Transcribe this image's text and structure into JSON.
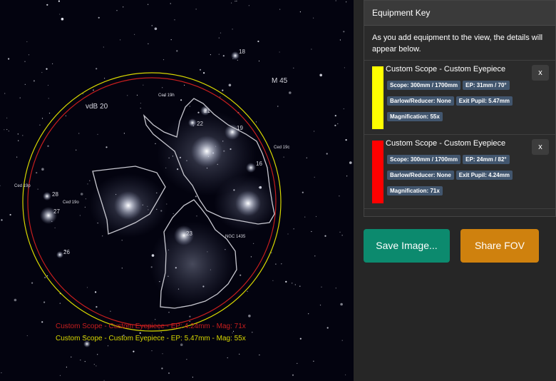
{
  "sky": {
    "labels": {
      "m45": "M 45",
      "vdb20": "vdB 20",
      "ced19h": "Ced 19h",
      "ced19c": "Ced 19c",
      "ced19p": "Ced 19p",
      "ced19o": "Ced 19o",
      "ngc1435": "NGC 1435",
      "s18a": "18",
      "s21": "21",
      "s22": "22",
      "s19": "19",
      "s16": "16",
      "s28": "28",
      "s27": "27",
      "s23": "23",
      "s26": "26"
    },
    "captions": {
      "red": "Custom Scope - Custom Eyepiece - EP: 4.24mm - Mag: 71x",
      "yellow": "Custom Scope - Custom Eyepiece - EP: 5.47mm - Mag: 55x"
    },
    "colors": {
      "yellow": "#d8d800",
      "red": "#c81e1e"
    }
  },
  "panel": {
    "title": "Equipment Key",
    "intro": "As you add equipment to the view, the details will appear below.",
    "entries": [
      {
        "name": "Custom Scope - Custom Eyepiece",
        "color": "#ffff00",
        "close": "x",
        "tags": [
          "Scope: 300mm / 1700mm",
          "EP: 31mm / 70°",
          "Barlow/Reducer: None",
          "Exit Pupil: 5.47mm",
          "Magnification: 55x"
        ]
      },
      {
        "name": "Custom Scope - Custom Eyepiece",
        "color": "#ff0000",
        "close": "x",
        "tags": [
          "Scope: 300mm / 1700mm",
          "EP: 24mm / 82°",
          "Barlow/Reducer: None",
          "Exit Pupil: 4.24mm",
          "Magnification: 71x"
        ]
      }
    ]
  },
  "buttons": {
    "save": "Save Image...",
    "share": "Share FOV"
  }
}
